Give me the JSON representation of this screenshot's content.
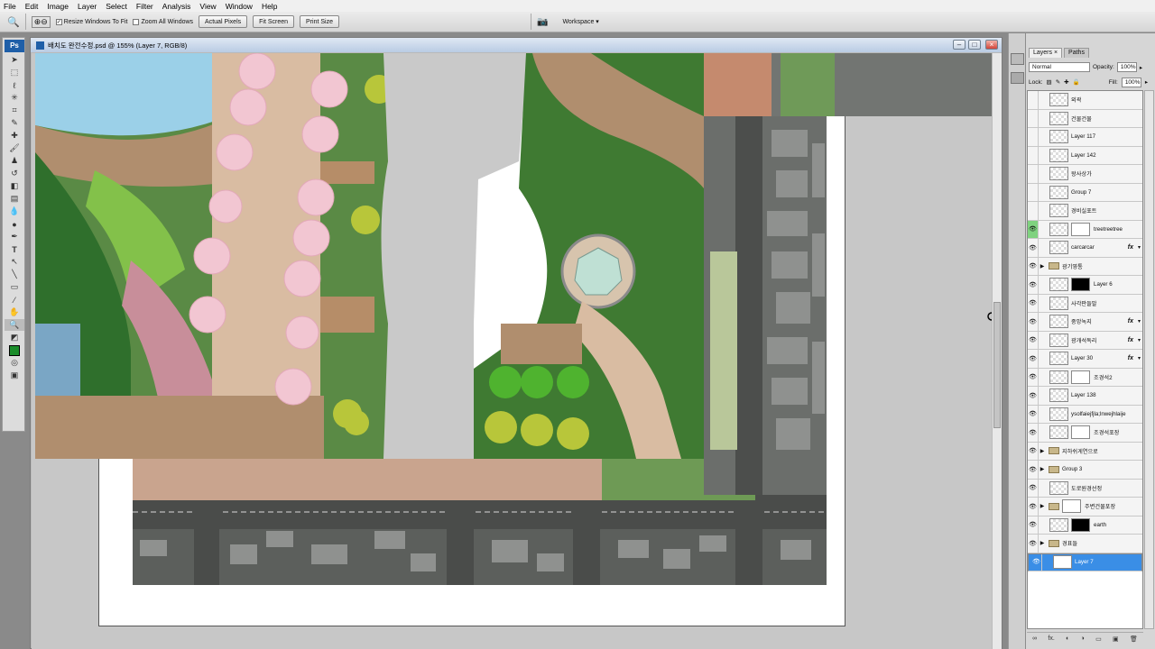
{
  "menu": [
    "File",
    "Edit",
    "Image",
    "Layer",
    "Select",
    "Filter",
    "Analysis",
    "View",
    "Window",
    "Help"
  ],
  "options": {
    "resize_windows_label": "Resize Windows To Fit",
    "resize_checked": true,
    "zoom_all_label": "Zoom All Windows",
    "zoom_all_checked": false,
    "actual_pixels": "Actual Pixels",
    "fit_screen": "Fit Screen",
    "print_size": "Print Size",
    "workspace": "Workspace ▾"
  },
  "document": {
    "title": "배치도 완전수정.psd @ 155% (Layer 7, RGB/8)"
  },
  "layers_panel": {
    "tabs": [
      "Layers ×",
      "Paths"
    ],
    "blend_mode": "Normal",
    "opacity_label": "Opacity:",
    "opacity": "100%",
    "lock_label": "Lock:",
    "fill_label": "Fill:",
    "fill": "100%",
    "layers": [
      {
        "name": "외곽",
        "visible": false,
        "type": "layer"
      },
      {
        "name": "건물건물",
        "visible": false,
        "type": "layer"
      },
      {
        "name": "Layer 117",
        "visible": false,
        "type": "layer"
      },
      {
        "name": "Layer 142",
        "visible": false,
        "type": "layer"
      },
      {
        "name": "왕사상가",
        "visible": false,
        "type": "layer"
      },
      {
        "name": "Group 7",
        "visible": false,
        "type": "layer"
      },
      {
        "name": "경비실포트",
        "visible": false,
        "type": "layer"
      },
      {
        "name": "treetreetree",
        "visible": true,
        "type": "layer",
        "mask": "white",
        "green": true
      },
      {
        "name": "carcarcar",
        "visible": true,
        "type": "layer",
        "fx": true
      },
      {
        "name": "광기영통",
        "visible": true,
        "type": "folder"
      },
      {
        "name": "Layer 6",
        "visible": true,
        "type": "layer",
        "mask": "black"
      },
      {
        "name": "사각판들말",
        "visible": true,
        "type": "layer"
      },
      {
        "name": "중앙녹지",
        "visible": true,
        "type": "layer",
        "fx": true
      },
      {
        "name": "광개석독리",
        "visible": true,
        "type": "layer",
        "fx": true
      },
      {
        "name": "Layer 30",
        "visible": true,
        "type": "layer",
        "fx": true
      },
      {
        "name": "조경석2",
        "visible": true,
        "type": "layer",
        "mask": "white"
      },
      {
        "name": "Layer 138",
        "visible": true,
        "type": "layer"
      },
      {
        "name": "ysolfaiejfjla;lnwejhlaije",
        "visible": true,
        "type": "layer"
      },
      {
        "name": "조경석포장",
        "visible": true,
        "type": "layer",
        "mask": "white"
      },
      {
        "name": "지하쉬게연으로",
        "visible": true,
        "type": "folder"
      },
      {
        "name": "Group 3",
        "visible": true,
        "type": "folder"
      },
      {
        "name": "도로원경선정",
        "visible": true,
        "type": "layer"
      },
      {
        "name": "주변건물포장",
        "visible": true,
        "type": "folder",
        "mask": "white"
      },
      {
        "name": "earth",
        "visible": true,
        "type": "layer",
        "mask": "black"
      },
      {
        "name": "경표들",
        "visible": true,
        "type": "folder"
      },
      {
        "name": "Layer 7",
        "visible": true,
        "type": "layer",
        "selected": true,
        "whitethumb": true
      }
    ],
    "bottom_icons": [
      "∞",
      "fx.",
      "◐",
      "◑",
      "▭",
      "▣",
      "🗑"
    ]
  },
  "colors": {
    "accent": "#3a8ee6",
    "foreground": "#000000",
    "background": "#1a8c2a"
  }
}
